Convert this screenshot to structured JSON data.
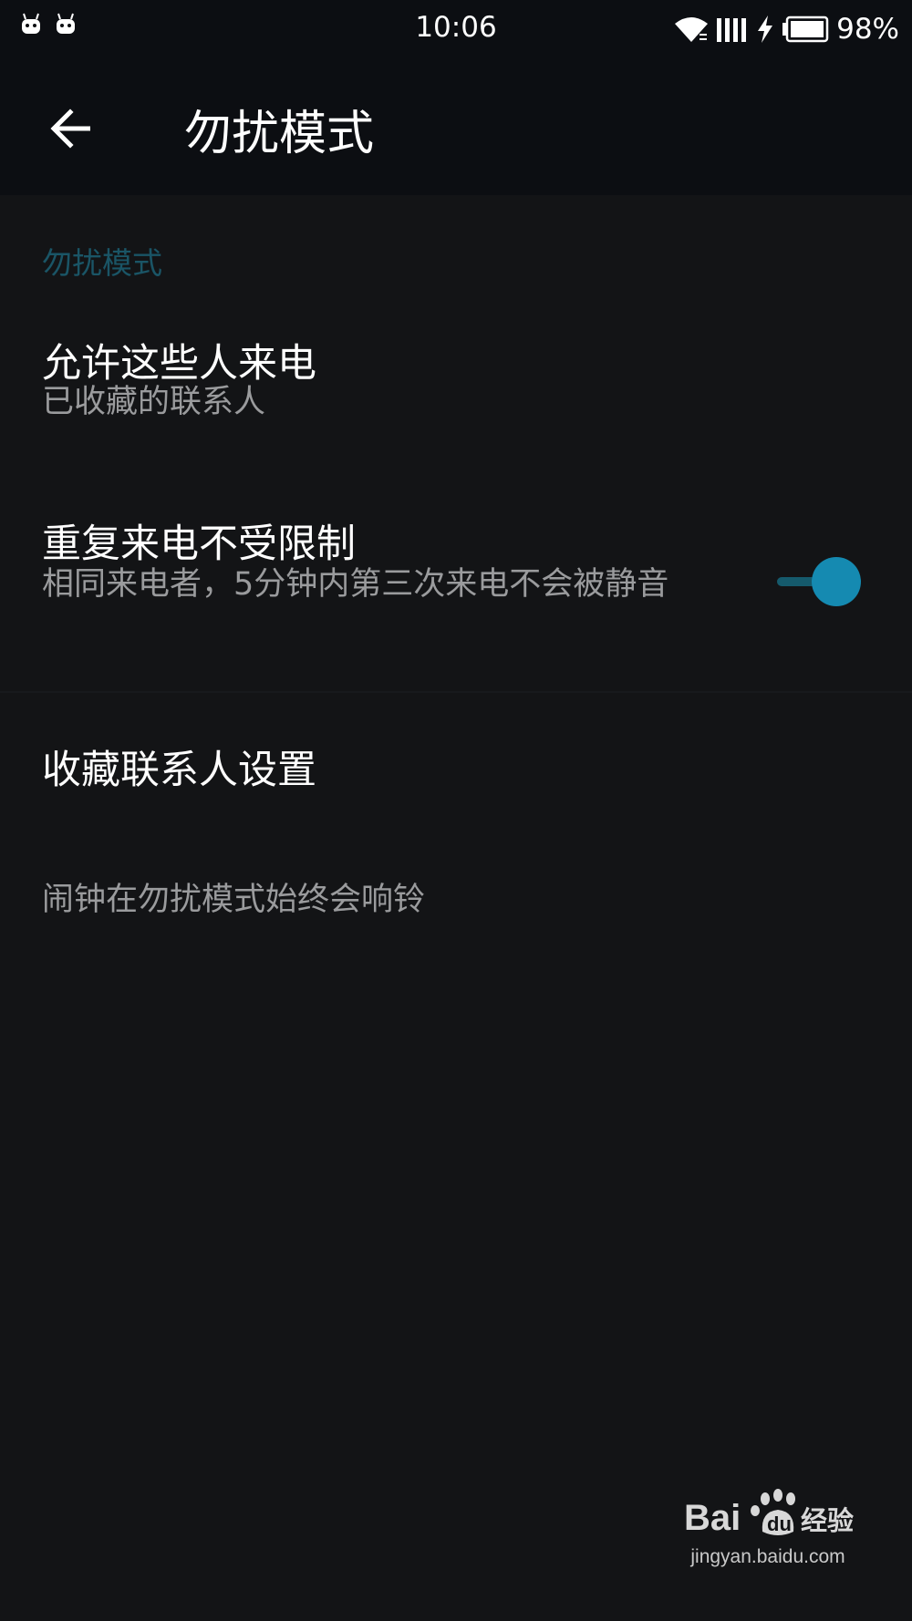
{
  "status_bar": {
    "time": "10:06",
    "battery": "98%",
    "left_icons": [
      "android-robot-icon",
      "android-robot-icon"
    ],
    "right_icons": [
      "wifi-icon",
      "signal-icon",
      "charging-icon",
      "battery-icon"
    ]
  },
  "toolbar": {
    "title": "勿扰模式",
    "back_icon": "arrow-left-icon"
  },
  "section": {
    "header": "勿扰模式"
  },
  "items": [
    {
      "title": "允许这些人来电",
      "summary": "已收藏的联系人"
    },
    {
      "title": "重复来电不受限制",
      "summary": "相同来电者，5分钟内第三次来电不会被静音",
      "switch_on": true
    },
    {
      "title": "收藏联系人设置"
    }
  ],
  "footer_note": "闹钟在勿扰模式始终会响铃",
  "watermark": {
    "logo": "Bai du 经验",
    "url": "jingyan.baidu.com"
  },
  "colors": {
    "background": "#131416",
    "toolbar": "#0c0e12",
    "accent": "#158ab1",
    "section_header": "#1a5566",
    "secondary_text": "#9a9b9d"
  }
}
